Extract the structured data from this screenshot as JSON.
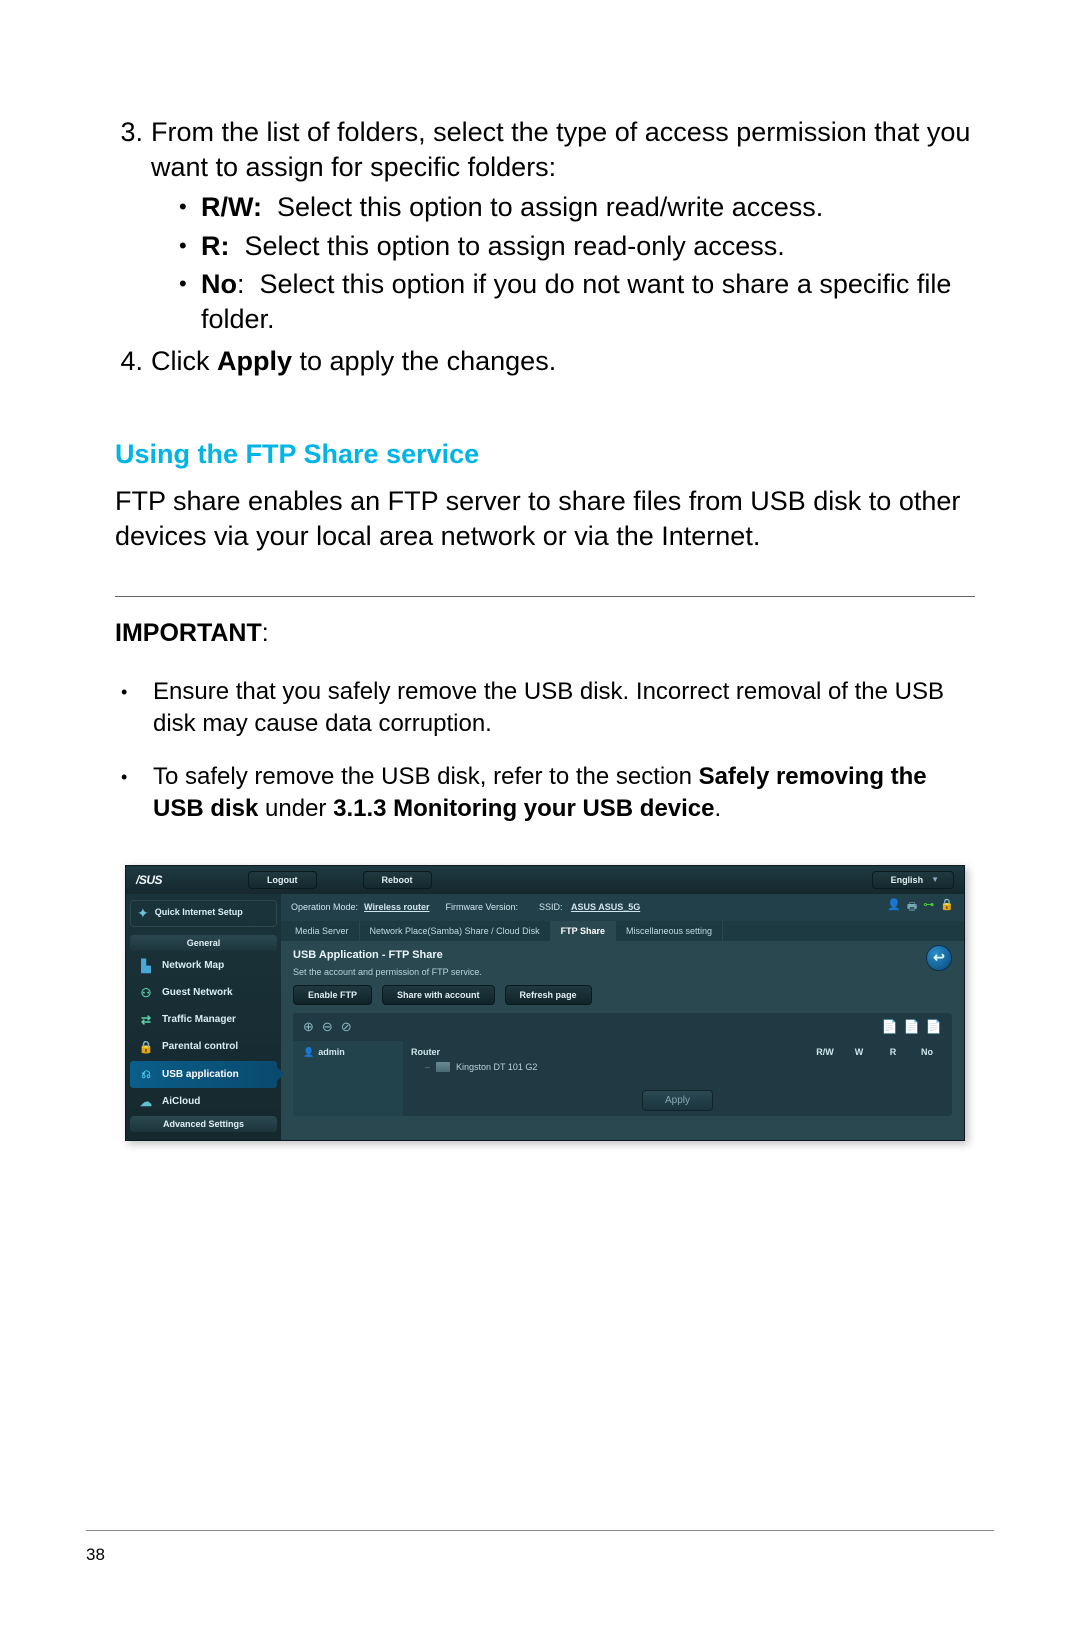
{
  "steps": {
    "s3": {
      "num": "3.",
      "text": "From the list of folders, select the type of access permission that you want to assign for specific folders:",
      "rw_label": "R/W:",
      "rw_text": "  Select this option to assign read/write access.",
      "r_label": "R:",
      "r_text": "  Select this option to assign read-only access.",
      "no_label": "No",
      "no_text": ":  Select this option if you do not want to share a specific file folder."
    },
    "s4": {
      "num": "4.",
      "pre": "Click ",
      "bold": "Apply",
      "post": " to apply the changes."
    }
  },
  "heading": "Using the FTP Share service",
  "ftp_para": "FTP share enables an FTP server to share files from USB disk to other devices via your local area network or via the Internet.",
  "important_label": "IMPORTANT",
  "important_colon": ":",
  "imp1": "Ensure that you safely remove the USB disk. Incorrect removal of the USB disk may cause data corruption.",
  "imp2_pre": "To safely remove the USB disk, refer to the section ",
  "imp2_b1": "Safely removing the USB disk",
  "imp2_mid": " under ",
  "imp2_b2": "3.1.3 Monitoring your USB device",
  "imp2_post": ".",
  "page_number": "38",
  "ui": {
    "logo": "/SUS",
    "logout": "Logout",
    "reboot": "Reboot",
    "english": "English",
    "qis": "Quick Internet Setup",
    "nav": {
      "general": "General",
      "network_map": "Network Map",
      "guest": "Guest Network",
      "traffic": "Traffic Manager",
      "parental": "Parental control",
      "usb_app": "USB application",
      "aicloud": "AiCloud",
      "advanced": "Advanced Settings"
    },
    "info": {
      "op_mode_label": "Operation Mode: ",
      "op_mode": "Wireless router",
      "fw_label": "    Firmware Version:",
      "ssid_label": "      SSID: ",
      "ssid": "ASUS  ASUS_5G"
    },
    "tabs": {
      "media": "Media Server",
      "samba": "Network Place(Samba) Share / Cloud Disk",
      "ftp": "FTP Share",
      "misc": "Miscellaneous setting"
    },
    "panel_title": "USB Application - FTP Share",
    "panel_sub": "Set the account and permission of FTP service.",
    "enable_ftp": "Enable FTP",
    "share_account": "Share with account",
    "refresh": "Refresh page",
    "admin": "admin",
    "router": "Router",
    "disk": "Kingston DT 101 G2",
    "perm": {
      "rw": "R/W",
      "w": "W",
      "r": "R",
      "no": "No"
    },
    "apply": "Apply"
  }
}
